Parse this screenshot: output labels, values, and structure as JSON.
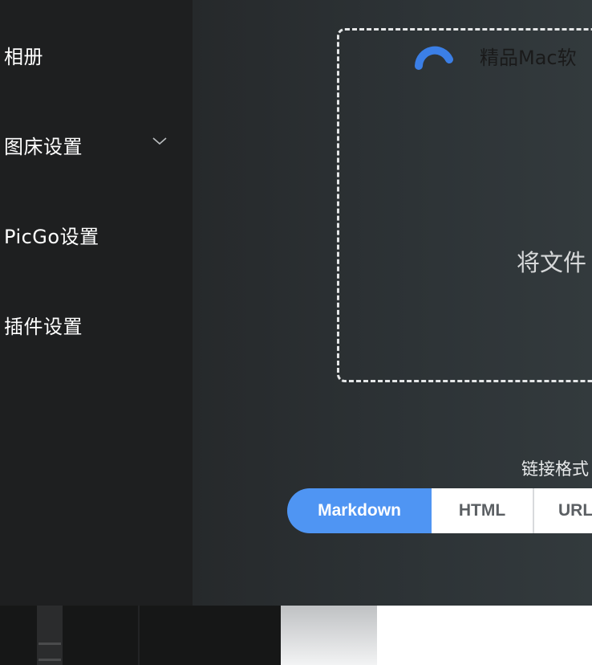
{
  "sidebar": {
    "items": [
      {
        "label": "相册",
        "icon": ""
      },
      {
        "label": "图床设置",
        "icon": "chevron-down-icon"
      },
      {
        "label": "PicGo设置",
        "icon": ""
      },
      {
        "label": "插件设置",
        "icon": ""
      }
    ]
  },
  "upload": {
    "dropzone_text": "将文件"
  },
  "link_format": {
    "label": "链接格式",
    "options": [
      "Markdown",
      "HTML",
      "URL"
    ],
    "selected": "Markdown"
  },
  "taskbar": {
    "promo_text": "精品Mac软"
  },
  "colors": {
    "accent": "#4f95f3",
    "sidebar_bg": "#1e1f20",
    "main_bg": "#2d3336"
  }
}
